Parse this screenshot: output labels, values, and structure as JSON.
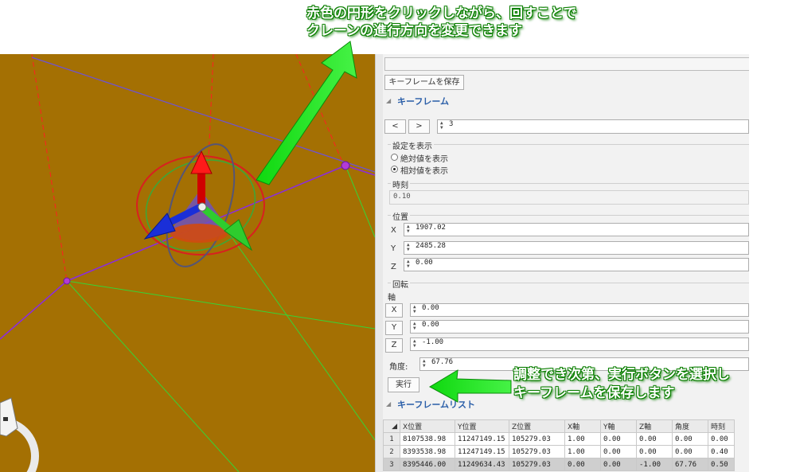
{
  "annotations": {
    "top_line1": "赤色の円形をクリックしながら、回すことで",
    "top_line2": "クレーンの進行方向を変更できます",
    "bottom_line1": "調整でき次第、実行ボタンを選択し",
    "bottom_line2": "キーフレームを保存します"
  },
  "panel": {
    "save_keyframe_button": "キーフレームを保存",
    "keyframe_section": "キーフレーム",
    "prev_button": "<",
    "next_button": ">",
    "keyframe_index": "3",
    "display_settings": {
      "title": "設定を表示",
      "option_absolute": "絶対値を表示",
      "option_relative": "相対値を表示",
      "selected": "relative"
    },
    "time": {
      "title": "時刻",
      "value": "0.10"
    },
    "position": {
      "title": "位置",
      "x_label": "X",
      "x_value": "1907.02",
      "y_label": "Y",
      "y_value": "2485.28",
      "z_label": "Z",
      "z_value": "0.00"
    },
    "rotation": {
      "title": "回転",
      "axis_label": "軸",
      "x_button": "X",
      "x_value": "0.00",
      "y_button": "Y",
      "y_value": "0.00",
      "z_button": "Z",
      "z_value": "-1.00",
      "angle_label": "角度:",
      "angle_value": "67.76"
    },
    "execute_button": "実行",
    "keyframe_list_section": "キーフレームリスト",
    "table": {
      "headers": [
        "",
        "X位置",
        "Y位置",
        "Z位置",
        "X軸",
        "Y軸",
        "Z軸",
        "角度",
        "時刻"
      ],
      "rows": [
        {
          "n": "1",
          "x": "8107538.98",
          "y": "11247149.15",
          "z": "105279.03",
          "ax": "1.00",
          "ay": "0.00",
          "az": "0.00",
          "angle": "0.00",
          "time": "0.00"
        },
        {
          "n": "2",
          "x": "8393538.98",
          "y": "11247149.15",
          "z": "105279.03",
          "ax": "1.00",
          "ay": "0.00",
          "az": "0.00",
          "angle": "0.00",
          "time": "0.40"
        },
        {
          "n": "3",
          "x": "8395446.00",
          "y": "11249634.43",
          "z": "105279.03",
          "ax": "0.00",
          "ay": "0.00",
          "az": "-1.00",
          "angle": "67.76",
          "time": "0.50"
        }
      ],
      "selected_row": 3
    }
  },
  "colors": {
    "viewport_bg": "#a47003",
    "annotation_green": "#19e619",
    "gizmo_red": "#e00000",
    "gizmo_green": "#2ecc2e",
    "gizmo_blue": "#1a2fd8",
    "path_purple": "#8a2be2",
    "section_blue": "#2a5ea8"
  }
}
